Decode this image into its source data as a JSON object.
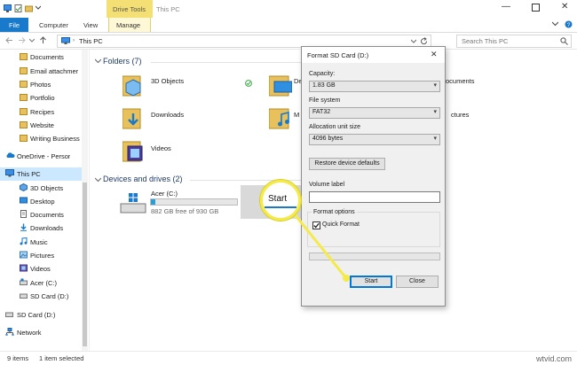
{
  "window": {
    "ribbon_context_header": "Drive Tools",
    "title": "This PC"
  },
  "ribbon": {
    "tabs": [
      "File",
      "Computer",
      "View",
      "Manage"
    ]
  },
  "address": {
    "path": "This PC",
    "search_placeholder": "Search This PC"
  },
  "nav": {
    "items": [
      {
        "label": "Documents",
        "icon": "folder-icon"
      },
      {
        "label": "Email attachmer",
        "icon": "folder-icon"
      },
      {
        "label": "Photos",
        "icon": "folder-icon"
      },
      {
        "label": "Portfolio",
        "icon": "folder-icon"
      },
      {
        "label": "Recipes",
        "icon": "folder-icon"
      },
      {
        "label": "Website",
        "icon": "folder-icon"
      },
      {
        "label": "Writing Business",
        "icon": "folder-icon"
      },
      {
        "label": "OneDrive - Persor",
        "icon": "cloud-icon"
      },
      {
        "label": "This PC",
        "icon": "computer-icon"
      },
      {
        "label": "3D Objects",
        "icon": "cube-icon"
      },
      {
        "label": "Desktop",
        "icon": "desktop-icon"
      },
      {
        "label": "Documents",
        "icon": "document-icon"
      },
      {
        "label": "Downloads",
        "icon": "download-icon"
      },
      {
        "label": "Music",
        "icon": "music-icon"
      },
      {
        "label": "Pictures",
        "icon": "picture-icon"
      },
      {
        "label": "Videos",
        "icon": "video-icon"
      },
      {
        "label": "Acer (C:)",
        "icon": "drive-icon"
      },
      {
        "label": "SD Card (D:)",
        "icon": "sd-card-icon"
      },
      {
        "label": "SD Card (D:)",
        "icon": "sd-card-icon"
      },
      {
        "label": "Network",
        "icon": "network-icon"
      }
    ]
  },
  "content": {
    "folders_title": "Folders (7)",
    "folders": [
      {
        "label": "3D Objects",
        "icon": "cube-folder-icon"
      },
      {
        "label": "De",
        "icon": "desktop-folder-icon"
      },
      {
        "label": "ocuments",
        "icon": "documents-folder-icon"
      },
      {
        "label": "Downloads",
        "icon": "downloads-folder-icon"
      },
      {
        "label": "M",
        "icon": "music-folder-icon"
      },
      {
        "label": "ctures",
        "icon": "pictures-folder-icon"
      },
      {
        "label": "Videos",
        "icon": "videos-folder-icon"
      }
    ],
    "devices_title": "Devices and drives (2)",
    "drives": [
      {
        "label": "Acer (C:)",
        "detail": "882 GB free of 930 GB",
        "used_fraction": 0.05
      }
    ]
  },
  "status": {
    "items_count": "9 items",
    "selected": "1 item selected"
  },
  "dialog": {
    "title": "Format SD Card (D:)",
    "capacity_label": "Capacity:",
    "capacity_value": "1.83 GB",
    "filesystem_label": "File system",
    "filesystem_value": "FAT32",
    "alloc_label": "Allocation unit size",
    "alloc_value": "4096 bytes",
    "restore_button": "Restore device defaults",
    "volume_label": "Volume label",
    "volume_value": "",
    "format_options_label": "Format options",
    "quick_format_label": "Quick Format",
    "quick_format_checked": true,
    "start_button": "Start",
    "close_button": "Close"
  },
  "callout": {
    "text": "Start",
    "color": "#f4ea4a"
  },
  "watermark": "wtvid.com",
  "colors": {
    "accent": "#1979ca",
    "selection": "#cce8ff",
    "context_tab": "#f3df73",
    "drive_fill": "#26a0da"
  }
}
